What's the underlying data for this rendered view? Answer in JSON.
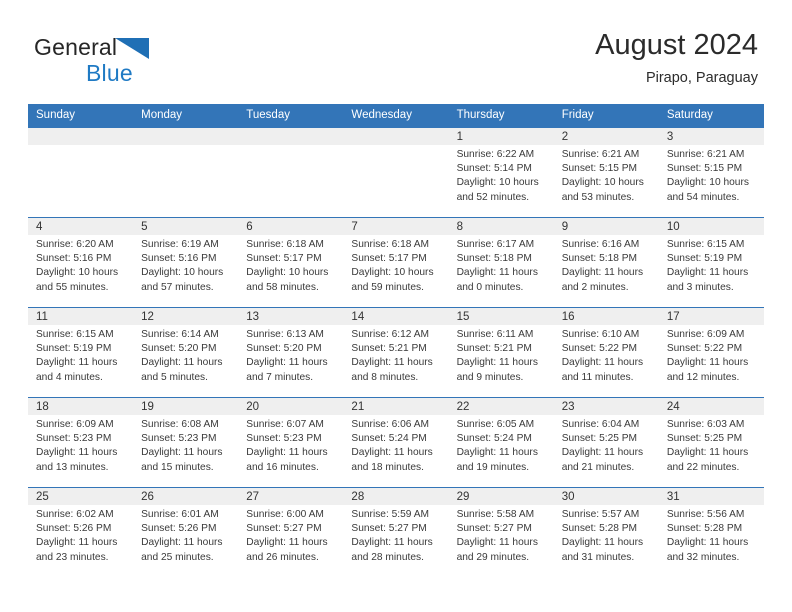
{
  "brand": {
    "name_part1": "General",
    "name_part2": "Blue",
    "flag_icon": "triangle-flag-icon"
  },
  "header": {
    "title": "August 2024",
    "subtitle": "Pirapo, Paraguay",
    "accent_color": "#3375b8",
    "daynum_bar_color": "#efefef"
  },
  "weekday_headers": [
    "Sunday",
    "Monday",
    "Tuesday",
    "Wednesday",
    "Thursday",
    "Friday",
    "Saturday"
  ],
  "weeks": [
    [
      {
        "day": "",
        "empty": true,
        "sunrise": "",
        "sunset": "",
        "daylight_line1": "",
        "daylight_line2": ""
      },
      {
        "day": "",
        "empty": true,
        "sunrise": "",
        "sunset": "",
        "daylight_line1": "",
        "daylight_line2": ""
      },
      {
        "day": "",
        "empty": true,
        "sunrise": "",
        "sunset": "",
        "daylight_line1": "",
        "daylight_line2": ""
      },
      {
        "day": "",
        "empty": true,
        "sunrise": "",
        "sunset": "",
        "daylight_line1": "",
        "daylight_line2": ""
      },
      {
        "day": "1",
        "empty": false,
        "sunrise": "Sunrise: 6:22 AM",
        "sunset": "Sunset: 5:14 PM",
        "daylight_line1": "Daylight: 10 hours",
        "daylight_line2": "and 52 minutes."
      },
      {
        "day": "2",
        "empty": false,
        "sunrise": "Sunrise: 6:21 AM",
        "sunset": "Sunset: 5:15 PM",
        "daylight_line1": "Daylight: 10 hours",
        "daylight_line2": "and 53 minutes."
      },
      {
        "day": "3",
        "empty": false,
        "sunrise": "Sunrise: 6:21 AM",
        "sunset": "Sunset: 5:15 PM",
        "daylight_line1": "Daylight: 10 hours",
        "daylight_line2": "and 54 minutes."
      }
    ],
    [
      {
        "day": "4",
        "empty": false,
        "sunrise": "Sunrise: 6:20 AM",
        "sunset": "Sunset: 5:16 PM",
        "daylight_line1": "Daylight: 10 hours",
        "daylight_line2": "and 55 minutes."
      },
      {
        "day": "5",
        "empty": false,
        "sunrise": "Sunrise: 6:19 AM",
        "sunset": "Sunset: 5:16 PM",
        "daylight_line1": "Daylight: 10 hours",
        "daylight_line2": "and 57 minutes."
      },
      {
        "day": "6",
        "empty": false,
        "sunrise": "Sunrise: 6:18 AM",
        "sunset": "Sunset: 5:17 PM",
        "daylight_line1": "Daylight: 10 hours",
        "daylight_line2": "and 58 minutes."
      },
      {
        "day": "7",
        "empty": false,
        "sunrise": "Sunrise: 6:18 AM",
        "sunset": "Sunset: 5:17 PM",
        "daylight_line1": "Daylight: 10 hours",
        "daylight_line2": "and 59 minutes."
      },
      {
        "day": "8",
        "empty": false,
        "sunrise": "Sunrise: 6:17 AM",
        "sunset": "Sunset: 5:18 PM",
        "daylight_line1": "Daylight: 11 hours",
        "daylight_line2": "and 0 minutes."
      },
      {
        "day": "9",
        "empty": false,
        "sunrise": "Sunrise: 6:16 AM",
        "sunset": "Sunset: 5:18 PM",
        "daylight_line1": "Daylight: 11 hours",
        "daylight_line2": "and 2 minutes."
      },
      {
        "day": "10",
        "empty": false,
        "sunrise": "Sunrise: 6:15 AM",
        "sunset": "Sunset: 5:19 PM",
        "daylight_line1": "Daylight: 11 hours",
        "daylight_line2": "and 3 minutes."
      }
    ],
    [
      {
        "day": "11",
        "empty": false,
        "sunrise": "Sunrise: 6:15 AM",
        "sunset": "Sunset: 5:19 PM",
        "daylight_line1": "Daylight: 11 hours",
        "daylight_line2": "and 4 minutes."
      },
      {
        "day": "12",
        "empty": false,
        "sunrise": "Sunrise: 6:14 AM",
        "sunset": "Sunset: 5:20 PM",
        "daylight_line1": "Daylight: 11 hours",
        "daylight_line2": "and 5 minutes."
      },
      {
        "day": "13",
        "empty": false,
        "sunrise": "Sunrise: 6:13 AM",
        "sunset": "Sunset: 5:20 PM",
        "daylight_line1": "Daylight: 11 hours",
        "daylight_line2": "and 7 minutes."
      },
      {
        "day": "14",
        "empty": false,
        "sunrise": "Sunrise: 6:12 AM",
        "sunset": "Sunset: 5:21 PM",
        "daylight_line1": "Daylight: 11 hours",
        "daylight_line2": "and 8 minutes."
      },
      {
        "day": "15",
        "empty": false,
        "sunrise": "Sunrise: 6:11 AM",
        "sunset": "Sunset: 5:21 PM",
        "daylight_line1": "Daylight: 11 hours",
        "daylight_line2": "and 9 minutes."
      },
      {
        "day": "16",
        "empty": false,
        "sunrise": "Sunrise: 6:10 AM",
        "sunset": "Sunset: 5:22 PM",
        "daylight_line1": "Daylight: 11 hours",
        "daylight_line2": "and 11 minutes."
      },
      {
        "day": "17",
        "empty": false,
        "sunrise": "Sunrise: 6:09 AM",
        "sunset": "Sunset: 5:22 PM",
        "daylight_line1": "Daylight: 11 hours",
        "daylight_line2": "and 12 minutes."
      }
    ],
    [
      {
        "day": "18",
        "empty": false,
        "sunrise": "Sunrise: 6:09 AM",
        "sunset": "Sunset: 5:23 PM",
        "daylight_line1": "Daylight: 11 hours",
        "daylight_line2": "and 13 minutes."
      },
      {
        "day": "19",
        "empty": false,
        "sunrise": "Sunrise: 6:08 AM",
        "sunset": "Sunset: 5:23 PM",
        "daylight_line1": "Daylight: 11 hours",
        "daylight_line2": "and 15 minutes."
      },
      {
        "day": "20",
        "empty": false,
        "sunrise": "Sunrise: 6:07 AM",
        "sunset": "Sunset: 5:23 PM",
        "daylight_line1": "Daylight: 11 hours",
        "daylight_line2": "and 16 minutes."
      },
      {
        "day": "21",
        "empty": false,
        "sunrise": "Sunrise: 6:06 AM",
        "sunset": "Sunset: 5:24 PM",
        "daylight_line1": "Daylight: 11 hours",
        "daylight_line2": "and 18 minutes."
      },
      {
        "day": "22",
        "empty": false,
        "sunrise": "Sunrise: 6:05 AM",
        "sunset": "Sunset: 5:24 PM",
        "daylight_line1": "Daylight: 11 hours",
        "daylight_line2": "and 19 minutes."
      },
      {
        "day": "23",
        "empty": false,
        "sunrise": "Sunrise: 6:04 AM",
        "sunset": "Sunset: 5:25 PM",
        "daylight_line1": "Daylight: 11 hours",
        "daylight_line2": "and 21 minutes."
      },
      {
        "day": "24",
        "empty": false,
        "sunrise": "Sunrise: 6:03 AM",
        "sunset": "Sunset: 5:25 PM",
        "daylight_line1": "Daylight: 11 hours",
        "daylight_line2": "and 22 minutes."
      }
    ],
    [
      {
        "day": "25",
        "empty": false,
        "sunrise": "Sunrise: 6:02 AM",
        "sunset": "Sunset: 5:26 PM",
        "daylight_line1": "Daylight: 11 hours",
        "daylight_line2": "and 23 minutes."
      },
      {
        "day": "26",
        "empty": false,
        "sunrise": "Sunrise: 6:01 AM",
        "sunset": "Sunset: 5:26 PM",
        "daylight_line1": "Daylight: 11 hours",
        "daylight_line2": "and 25 minutes."
      },
      {
        "day": "27",
        "empty": false,
        "sunrise": "Sunrise: 6:00 AM",
        "sunset": "Sunset: 5:27 PM",
        "daylight_line1": "Daylight: 11 hours",
        "daylight_line2": "and 26 minutes."
      },
      {
        "day": "28",
        "empty": false,
        "sunrise": "Sunrise: 5:59 AM",
        "sunset": "Sunset: 5:27 PM",
        "daylight_line1": "Daylight: 11 hours",
        "daylight_line2": "and 28 minutes."
      },
      {
        "day": "29",
        "empty": false,
        "sunrise": "Sunrise: 5:58 AM",
        "sunset": "Sunset: 5:27 PM",
        "daylight_line1": "Daylight: 11 hours",
        "daylight_line2": "and 29 minutes."
      },
      {
        "day": "30",
        "empty": false,
        "sunrise": "Sunrise: 5:57 AM",
        "sunset": "Sunset: 5:28 PM",
        "daylight_line1": "Daylight: 11 hours",
        "daylight_line2": "and 31 minutes."
      },
      {
        "day": "31",
        "empty": false,
        "sunrise": "Sunrise: 5:56 AM",
        "sunset": "Sunset: 5:28 PM",
        "daylight_line1": "Daylight: 11 hours",
        "daylight_line2": "and 32 minutes."
      }
    ]
  ]
}
